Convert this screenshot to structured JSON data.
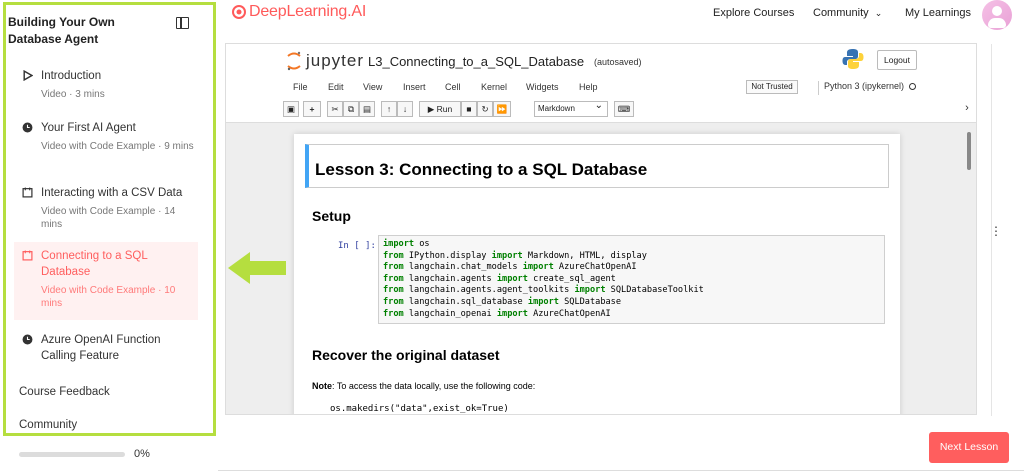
{
  "sidebar": {
    "course_title": "Building Your Own Database Agent",
    "lessons": [
      {
        "title": "Introduction",
        "meta": "Video · 3 mins",
        "icon": "play-icon"
      },
      {
        "title": "Your First AI Agent",
        "meta": "Video with Code Example · 9 mins",
        "icon": "clock-icon"
      },
      {
        "title": "Interacting with a CSV Data",
        "meta": "Video with Code Example · 14 mins",
        "icon": "notebook-icon"
      },
      {
        "title": "Connecting to a SQL Database",
        "meta": "Video with Code Example · 10 mins",
        "icon": "notebook-icon"
      },
      {
        "title": "Azure OpenAI Function Calling Feature",
        "meta": "",
        "icon": "clock-icon"
      }
    ],
    "links": [
      "Course Feedback",
      "Community"
    ],
    "progress_label": "0%",
    "progress_value": 0
  },
  "topnav": {
    "brand": "DeepLearning.AI",
    "explore": "Explore Courses",
    "community": "Community",
    "my_learnings": "My Learnings"
  },
  "jupyter": {
    "logo_word": "jupyter",
    "notebook_name": "L3_Connecting_to_a_SQL_Database",
    "autosaved": "(autosaved)",
    "logout": "Logout",
    "menu": [
      "File",
      "Edit",
      "View",
      "Insert",
      "Cell",
      "Kernel",
      "Widgets",
      "Help"
    ],
    "trust": "Not Trusted",
    "kernel": "Python 3 (ipykernel)",
    "run_label": "Run",
    "cell_type": "Markdown",
    "lesson_title": "Lesson 3: Connecting to a SQL Database",
    "setup_heading": "Setup",
    "prompt": "In [ ]:",
    "code_lines": [
      [
        "import",
        " os"
      ],
      [
        "from",
        " IPython.display ",
        "import",
        " Markdown, HTML, display"
      ],
      [
        "from",
        " langchain.chat_models ",
        "import",
        " AzureChatOpenAI"
      ],
      [
        "from",
        " langchain.agents ",
        "import",
        " create_sql_agent"
      ],
      [
        "from",
        " langchain.agents.agent_toolkits ",
        "import",
        " SQLDatabaseToolkit"
      ],
      [
        "from",
        " langchain.sql_database ",
        "import",
        " SQLDatabase"
      ],
      [
        "from",
        " langchain_openai ",
        "import",
        " AzureChatOpenAI"
      ]
    ],
    "recover_heading": "Recover the original dataset",
    "note_bold": "Note",
    "note_text": ": To access the data locally, use the following code:",
    "code2": "os.makedirs(\"data\",exist_ok=True)"
  },
  "next_button": "Next Lesson",
  "colors": {
    "accent": "#ff5e5e",
    "highlight_border": "#b5de3f",
    "arrow": "#b5de3f"
  }
}
